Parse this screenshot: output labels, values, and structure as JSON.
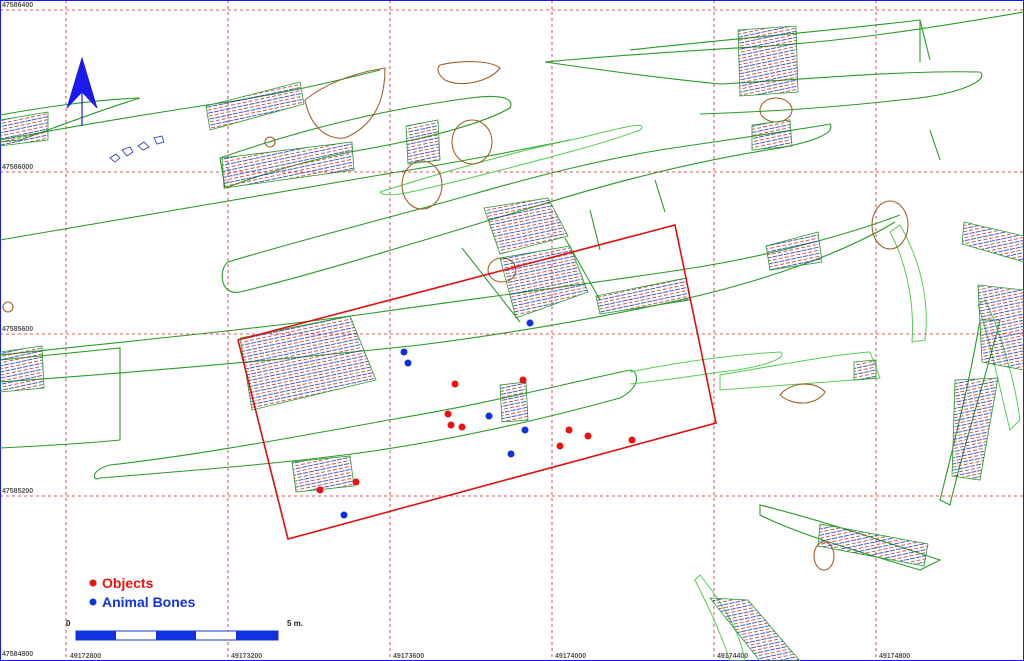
{
  "colors": {
    "grid": "#cc2222",
    "feature": "#2a9a2a",
    "feature_light": "#55cc55",
    "pit": "#a0602a",
    "hatch_red": "#b03030",
    "hatch_blue": "#2030a0",
    "trench": "#dd1111",
    "objects": "#ee1111",
    "bones": "#1133dd",
    "north": "#1a1aee"
  },
  "grid_labels": {
    "y": [
      "47586400",
      "47586000",
      "47585600",
      "47585200",
      "47584800"
    ],
    "x": [
      "49172800",
      "49173200",
      "49173600",
      "49174000",
      "49174400",
      "49174800"
    ]
  },
  "legend": {
    "objects_label": "Objects",
    "bones_label": "Animal Bones"
  },
  "scale": {
    "start": "0",
    "end": "5 m."
  },
  "icons": {
    "north": "north-arrow-icon"
  }
}
